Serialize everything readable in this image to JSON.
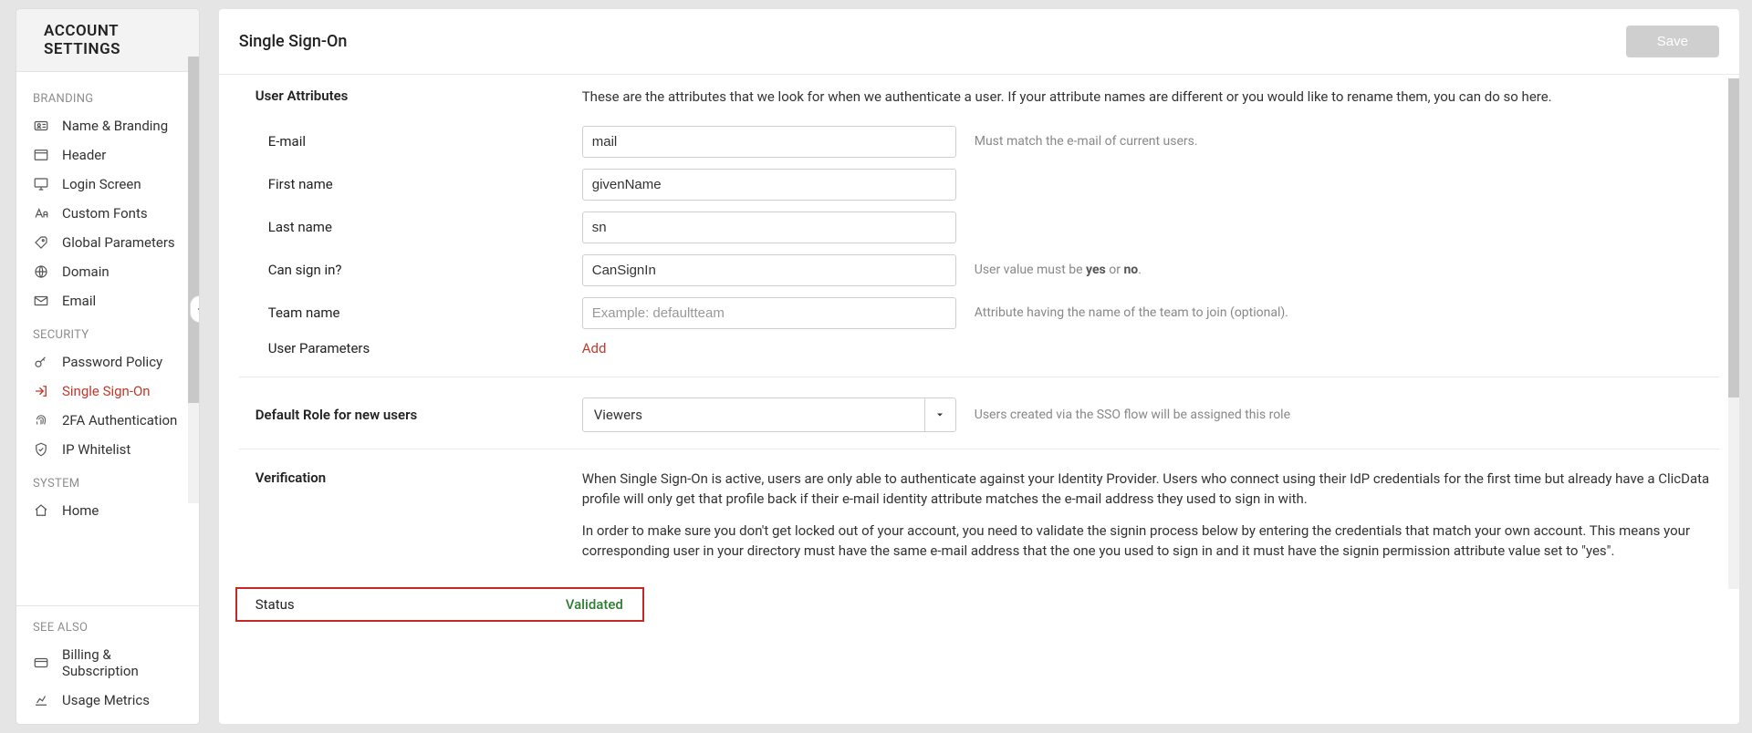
{
  "sidebar": {
    "title": "ACCOUNT SETTINGS",
    "groups": {
      "branding": "BRANDING",
      "security": "SECURITY",
      "system": "SYSTEM",
      "see_also": "SEE ALSO"
    },
    "items": {
      "name_branding": "Name & Branding",
      "header": "Header",
      "login_screen": "Login Screen",
      "custom_fonts": "Custom Fonts",
      "global_params": "Global Parameters",
      "domain": "Domain",
      "email": "Email",
      "password_policy": "Password Policy",
      "sso": "Single Sign-On",
      "two_fa": "2FA Authentication",
      "ip_whitelist": "IP Whitelist",
      "home": "Home",
      "billing": "Billing & Subscription",
      "usage_metrics": "Usage Metrics"
    }
  },
  "page": {
    "title": "Single Sign-On",
    "save": "Save"
  },
  "user_attributes": {
    "heading": "User Attributes",
    "description": "These are the attributes that we look for when we authenticate a user. If your attribute names are different or you would like to rename them, you can do so here.",
    "email_label": "E-mail",
    "email_value": "mail",
    "email_hint": "Must match the e-mail of current users.",
    "firstname_label": "First name",
    "firstname_value": "givenName",
    "lastname_label": "Last name",
    "lastname_value": "sn",
    "cansignin_label": "Can sign in?",
    "cansignin_value": "CanSignIn",
    "cansignin_hint_prefix": "User value must be ",
    "cansignin_hint_yes": "yes",
    "cansignin_hint_or": " or ",
    "cansignin_hint_no": "no",
    "cansignin_hint_suffix": ".",
    "team_label": "Team name",
    "team_placeholder": "Example: defaultteam",
    "team_hint": "Attribute having the name of the team to join (optional).",
    "user_params_label": "User Parameters",
    "user_params_add": "Add"
  },
  "default_role": {
    "label": "Default Role for new users",
    "value": "Viewers",
    "hint": "Users created via the SSO flow will be assigned this role"
  },
  "verification": {
    "heading": "Verification",
    "p1": "When Single Sign-On is active, users are only able to authenticate against your Identity Provider. Users who connect using their IdP credentials for the first time but already have a ClicData profile will only get that profile back if their e-mail identity attribute matches the e-mail address they used to sign in with.",
    "p2": "In order to make sure you don't get locked out of your account, you need to validate the signin process below by entering the credentials that match your own account. This means your corresponding user in your directory must have the same e-mail address that the one you used to sign in and it must have the signin permission attribute value set to \"yes\"."
  },
  "status": {
    "label": "Status",
    "value": "Validated"
  }
}
